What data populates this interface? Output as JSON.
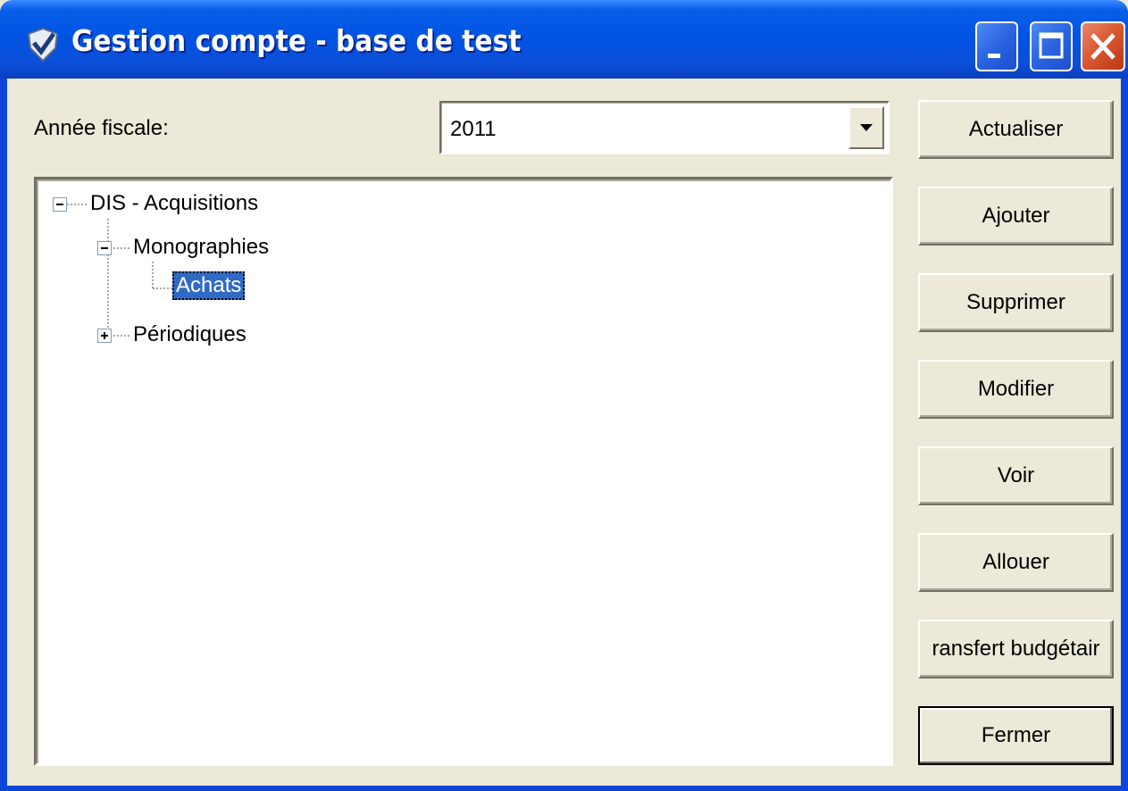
{
  "window": {
    "title": "Gestion compte - base de test",
    "icons": {
      "app": "checkmark-shield-icon",
      "minimize": "minimize-icon",
      "maximize": "maximize-icon",
      "close": "close-icon"
    }
  },
  "fiscal_year": {
    "label": "Année fiscale:",
    "selected": "2011"
  },
  "tree": {
    "nodes": [
      {
        "label": "DIS - Acquisitions",
        "expanded": true,
        "level": 0
      },
      {
        "label": "Monographies",
        "expanded": true,
        "level": 1
      },
      {
        "label": "Achats",
        "selected": true,
        "level": 2
      },
      {
        "label": "Périodiques",
        "expanded": false,
        "level": 1
      }
    ]
  },
  "buttons": {
    "refresh": "Actualiser",
    "add": "Ajouter",
    "delete": "Supprimer",
    "edit": "Modifier",
    "view": "Voir",
    "allocate": "Allouer",
    "transfer": "ransfert budgétair",
    "close": "Fermer"
  },
  "colors": {
    "titlebar": "#0054E3",
    "selection": "#316AC5",
    "face": "#ECE9D8"
  }
}
